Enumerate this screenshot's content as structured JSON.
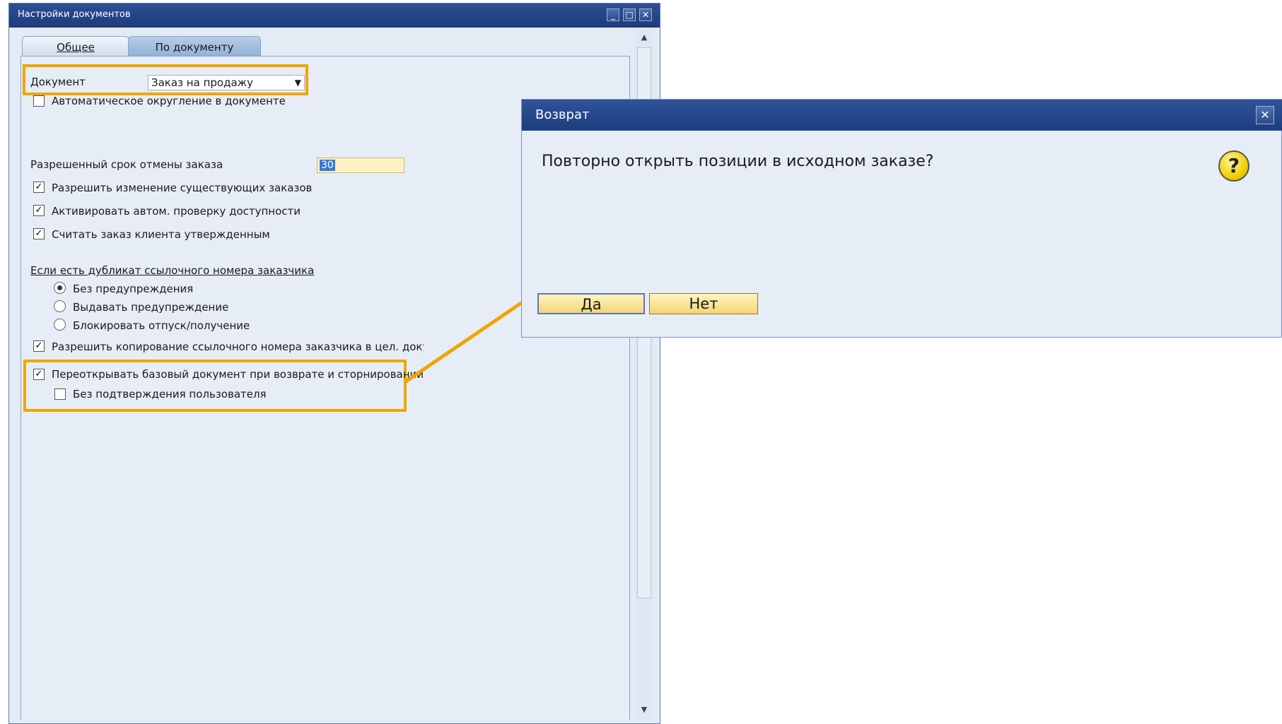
{
  "window": {
    "title": "Настройки документов"
  },
  "tabs": [
    {
      "label": "Общее"
    },
    {
      "label": "По документу"
    }
  ],
  "form": {
    "document_label": "Документ",
    "document_value": "Заказ на продажу",
    "auto_rounding": {
      "label": "Автоматическое округление в документе",
      "checked": false
    },
    "cancel_term": {
      "label": "Разрешенный срок отмены заказа",
      "value": "30"
    },
    "checkboxes": [
      {
        "label": "Разрешить изменение существующих заказов",
        "checked": true
      },
      {
        "label": "Активировать автом. проверку доступности",
        "checked": true
      },
      {
        "label": "Считать заказ клиента утвержденным",
        "checked": true
      }
    ],
    "duplicate_section": {
      "title": "Если есть дубликат ссылочного номера заказчика",
      "options": [
        {
          "label": "Без предупреждения",
          "selected": true
        },
        {
          "label": "Выдавать предупреждение",
          "selected": false
        },
        {
          "label": "Блокировать отпуск/получение",
          "selected": false
        }
      ]
    },
    "allow_copy": {
      "label": "Разрешить копирование ссылочного номера заказчика в цел. докумен",
      "checked": true
    },
    "reopen_base": {
      "label": "Переоткрывать базовый документ при возврате и сторнировании",
      "checked": true
    },
    "no_confirm": {
      "label": "Без подтверждения пользователя",
      "checked": false
    }
  },
  "dialog": {
    "title": "Возврат",
    "message": "Повторно открыть позиции в исходном заказе?",
    "icon": "question-icon",
    "yes_label": "Да",
    "no_label": "Нет"
  },
  "colors": {
    "highlight": "#f0a500",
    "titlebar": "#1d3b7c"
  }
}
